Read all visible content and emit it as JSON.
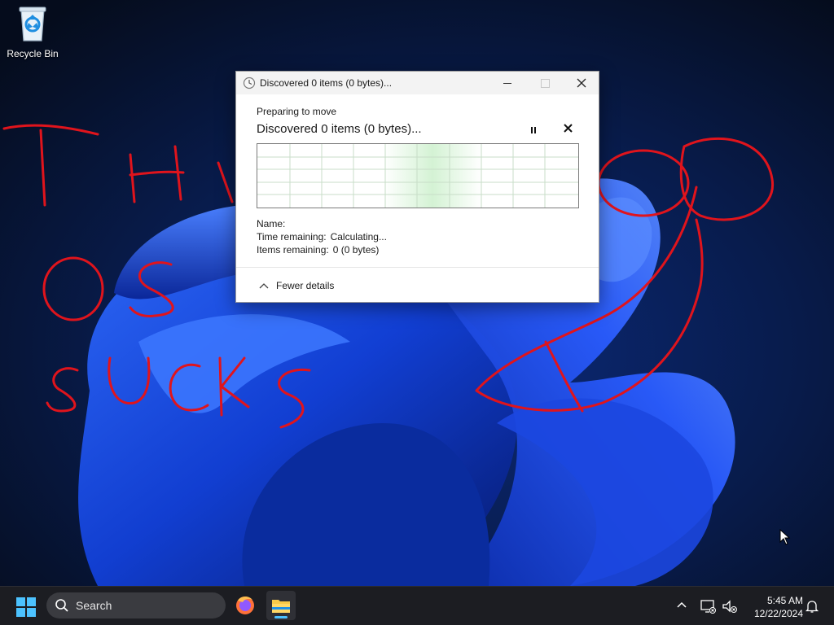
{
  "desktop": {
    "recycle_bin_label": "Recycle Bin",
    "graffiti": [
      "THI",
      "OS",
      "SUCKS"
    ]
  },
  "dialog": {
    "title": "Discovered 0 items (0 bytes)...",
    "status_small": "Preparing to move",
    "status_big": "Discovered 0 items (0 bytes)...",
    "pause_icon": "pause-icon",
    "cancel_icon": "close-icon",
    "name_label": "Name:",
    "name_value": "",
    "time_label": "Time remaining:",
    "time_value": "Calculating...",
    "items_label": "Items remaining:",
    "items_value": "0 (0 bytes)",
    "fewer_details": "Fewer details",
    "progress_fraction": 0
  },
  "taskbar": {
    "search_placeholder": "Search",
    "apps": [
      "firefox-icon",
      "file-explorer-icon"
    ],
    "time": "5:45 AM",
    "date": "12/22/2024"
  },
  "colors": {
    "graffiti": "#e0141c",
    "accent": "#4cc2ff",
    "graph_fill": "#c9efc9"
  }
}
